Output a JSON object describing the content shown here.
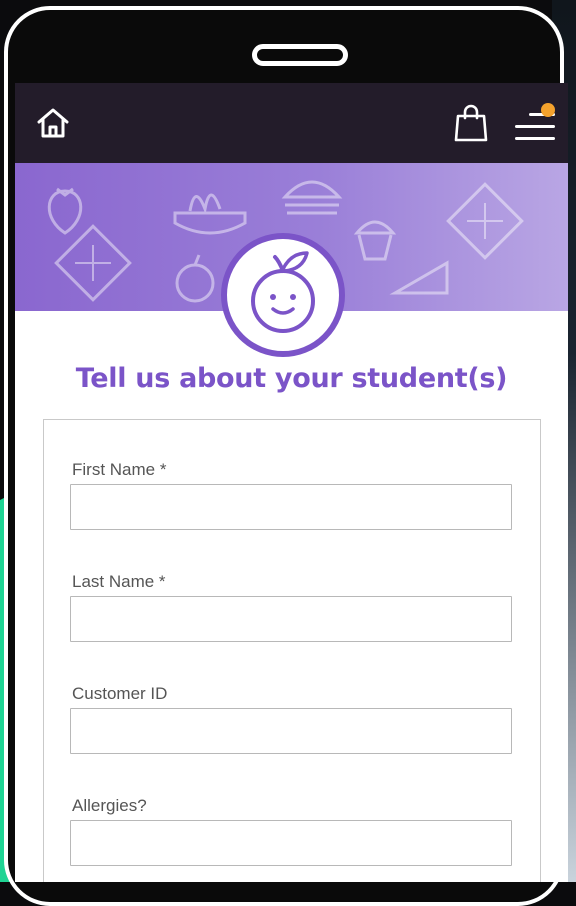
{
  "header": {
    "home_icon": "home-icon",
    "bag_icon": "shopping-bag-icon",
    "menu_icon": "hamburger-menu-icon",
    "notification_color": "#f4a22d"
  },
  "brand": {
    "logo_icon": "smiling-apple-icon",
    "accent": "#7b54c8"
  },
  "page": {
    "title": "Tell us about your student(s)"
  },
  "form": {
    "fields": [
      {
        "label": "First Name *",
        "value": "",
        "placeholder": ""
      },
      {
        "label": "Last Name *",
        "value": "",
        "placeholder": ""
      },
      {
        "label": "Customer ID",
        "value": "",
        "placeholder": ""
      },
      {
        "label": "Allergies?",
        "value": "",
        "placeholder": ""
      }
    ]
  }
}
